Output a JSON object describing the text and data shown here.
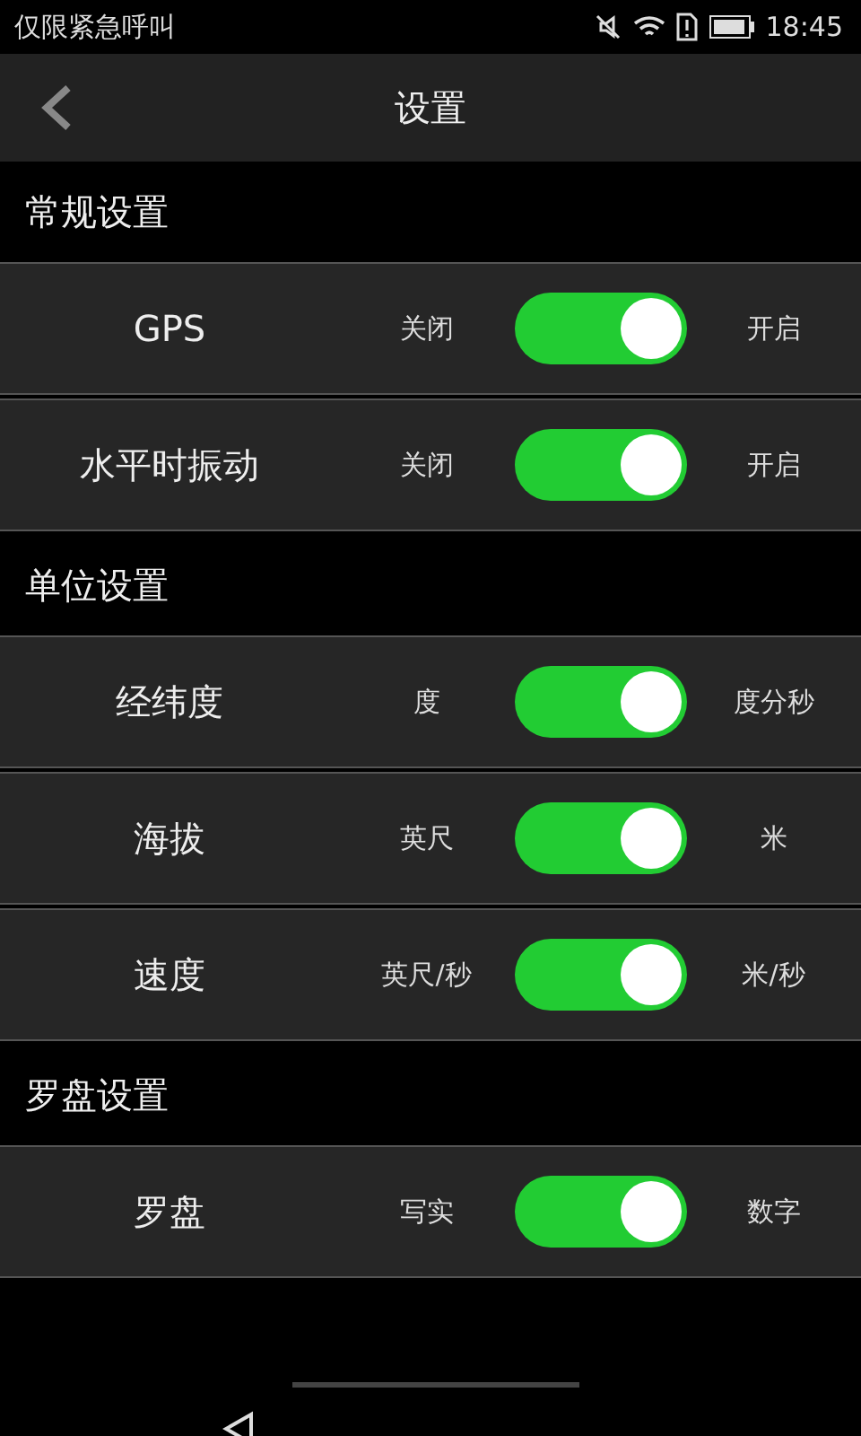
{
  "status_bar": {
    "carrier": "仅限紧急呼叫",
    "time": "18:45"
  },
  "header": {
    "title": "设置"
  },
  "sections": [
    {
      "title": "常规设置",
      "rows": [
        {
          "label": "GPS",
          "off_label": "关闭",
          "on_label": "开启",
          "on": true
        },
        {
          "label": "水平时振动",
          "off_label": "关闭",
          "on_label": "开启",
          "on": true
        }
      ]
    },
    {
      "title": "单位设置",
      "rows": [
        {
          "label": "经纬度",
          "off_label": "度",
          "on_label": "度分秒",
          "on": true
        },
        {
          "label": "海拔",
          "off_label": "英尺",
          "on_label": "米",
          "on": true
        },
        {
          "label": "速度",
          "off_label": "英尺/秒",
          "on_label": "米/秒",
          "on": true
        }
      ]
    },
    {
      "title": "罗盘设置",
      "rows": [
        {
          "label": "罗盘",
          "off_label": "写实",
          "on_label": "数字",
          "on": true
        }
      ]
    }
  ]
}
